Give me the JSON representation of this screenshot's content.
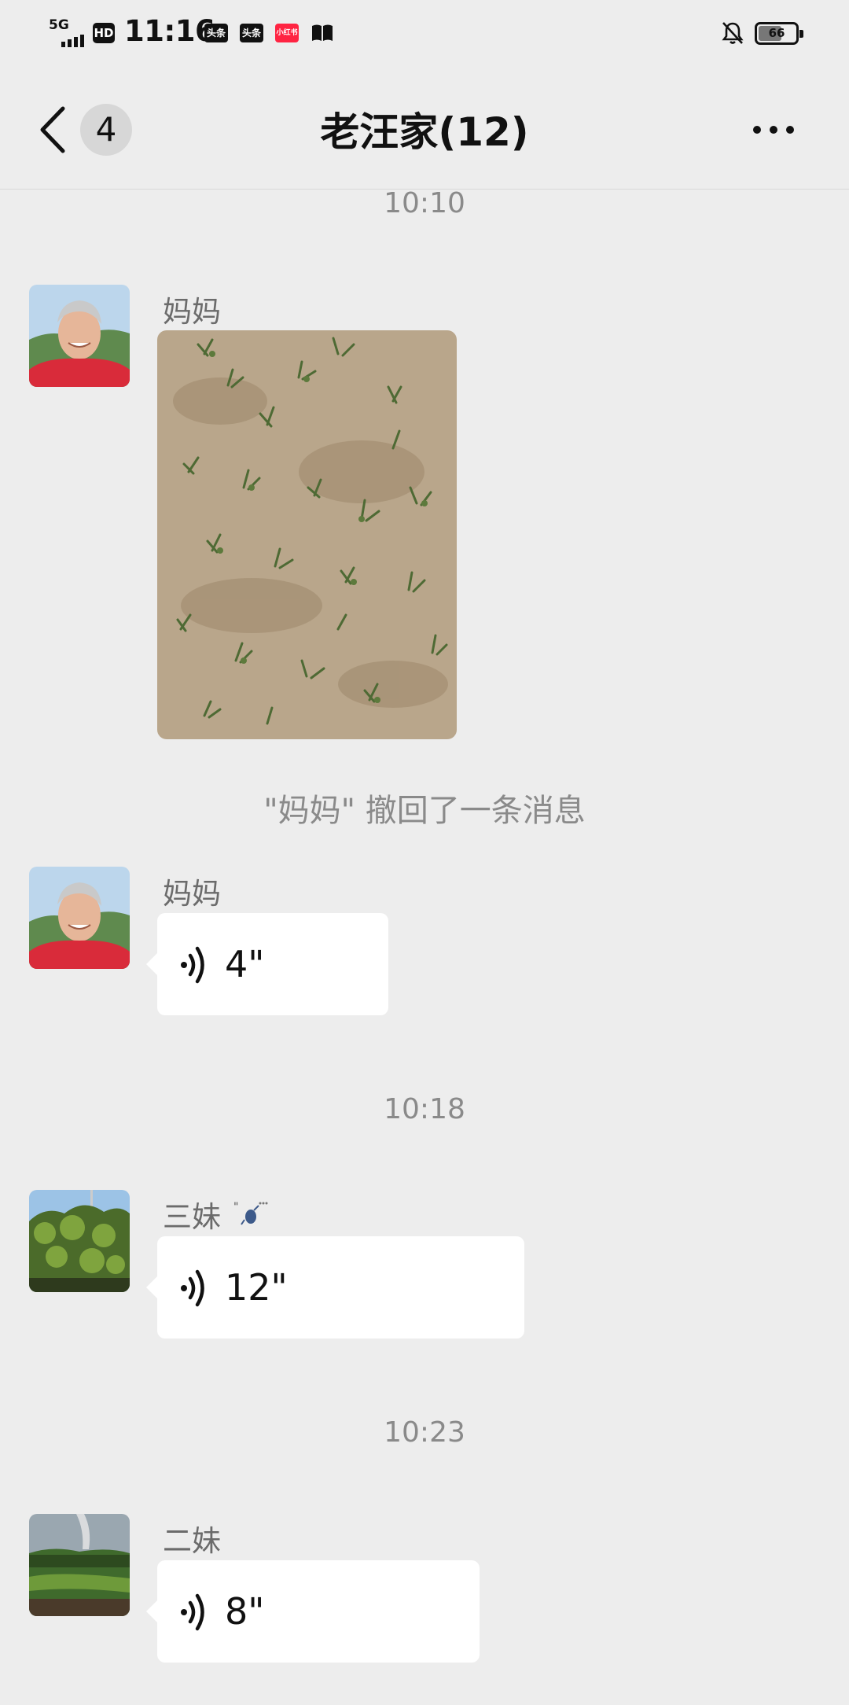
{
  "status_bar": {
    "network": "5G",
    "hd": "HD",
    "time": "11:16",
    "apps": [
      "头条",
      "头条",
      "小红书"
    ],
    "battery": "66",
    "icons": [
      "signal-icon",
      "silent-bell-icon",
      "book-icon",
      "battery-icon"
    ]
  },
  "nav": {
    "back_icon": "chevron-left-icon",
    "unread_count": "4",
    "title": "老汪家(12)",
    "more_icon": "more-dots-icon"
  },
  "chat": {
    "timestamps": [
      "10:10",
      "10:18",
      "10:23"
    ],
    "recall_notice": "\"妈妈\" 撤回了一条消息",
    "messages": [
      {
        "sender": "妈妈",
        "type": "image"
      },
      {
        "sender": "妈妈",
        "type": "voice",
        "duration": "4\""
      },
      {
        "sender": "三妹",
        "type": "voice",
        "duration": "12\""
      },
      {
        "sender": "二妹",
        "type": "voice",
        "duration": "8\""
      }
    ]
  }
}
